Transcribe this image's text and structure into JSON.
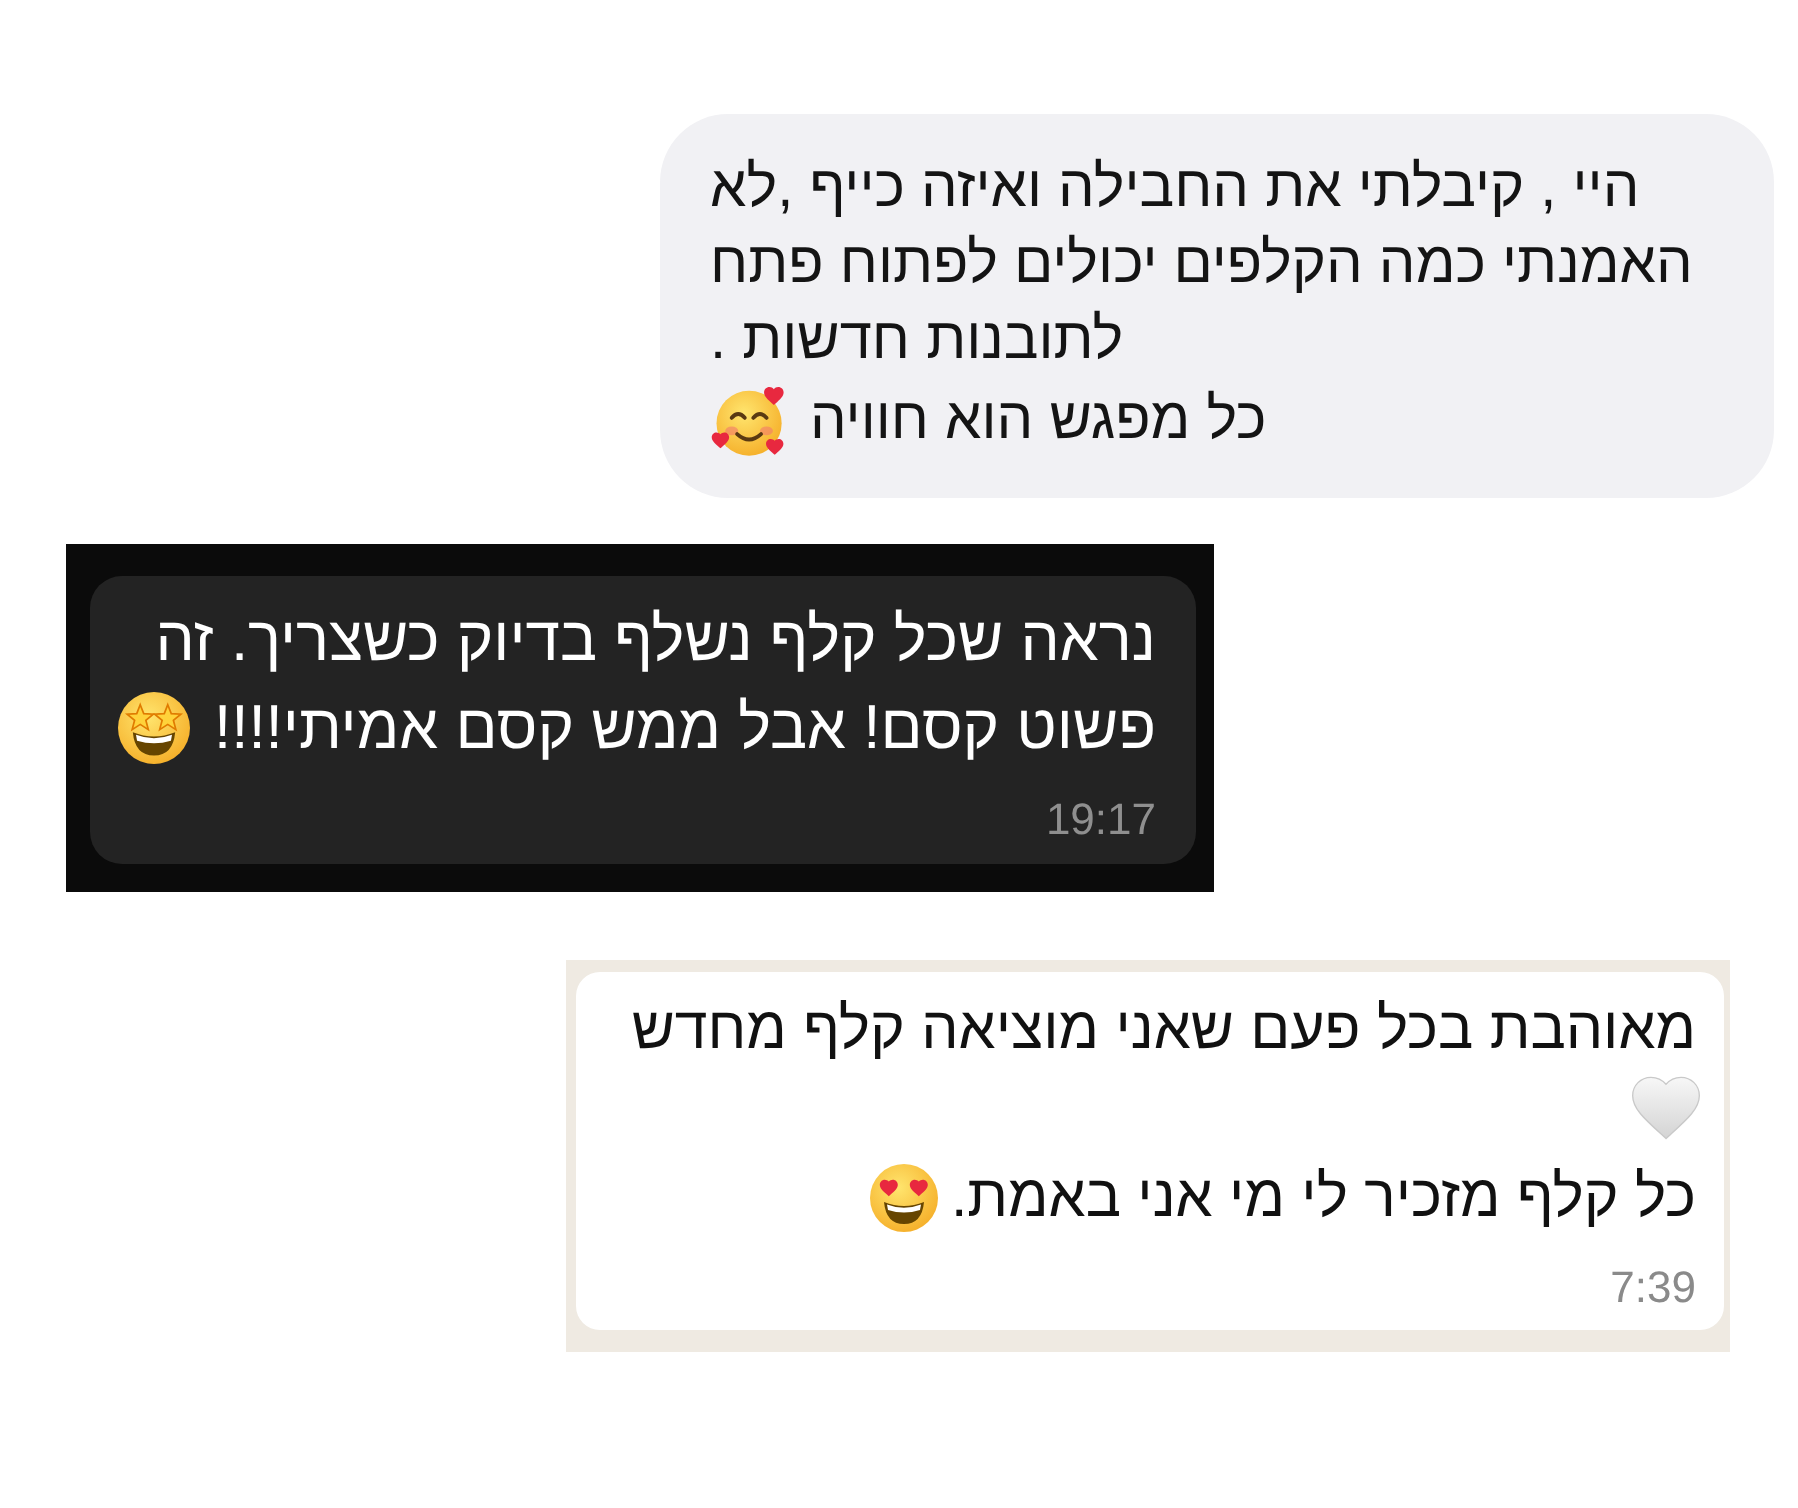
{
  "messages": [
    {
      "kind": "imessage",
      "lines": [
        "היי , קיבלתי את החבילה ואיזה כייף ,לא",
        "האמנתי כמה הקלפים יכולים לפתוח פתח",
        "לתובנות חדשות .",
        "כל מפגש הוא חוויה"
      ]
    },
    {
      "kind": "whatsapp-dark",
      "lines": [
        "נראה שכל קלף נשלף בדיוק כשצריך. זה",
        "פשוט קסם! אבל ממש קסם אמיתי!!!!"
      ],
      "time": "19:17"
    },
    {
      "kind": "whatsapp-light",
      "lines": [
        "מאוהבת בכל פעם שאני מוציאה קלף מחדש",
        "כל קלף מזכיר לי מי אני באמת."
      ],
      "time": "7:39"
    }
  ]
}
